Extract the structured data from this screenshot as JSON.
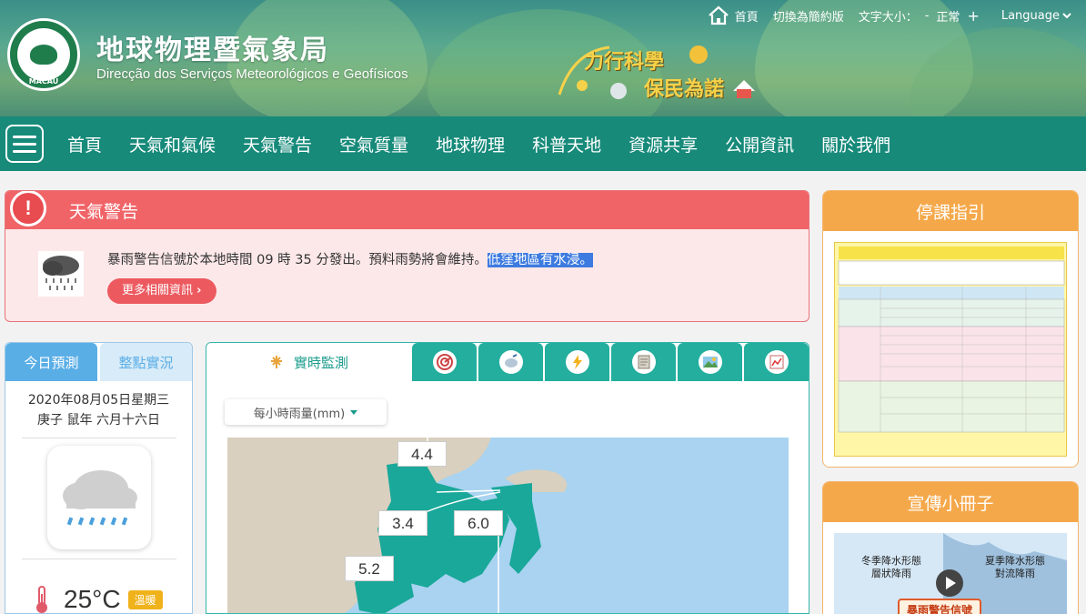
{
  "header": {
    "site_title": "地球物理暨氣象局",
    "site_subtitle": "Direcção dos Serviços Meteorológicos e Geofísicos",
    "logo_text": "MACAU",
    "slogan_line1": "力行科學",
    "slogan_line2": "保民為諾",
    "top_links": {
      "home": "首頁",
      "simplified": "切換為簡約版",
      "font_size_label": "文字大小：",
      "font_minus": "-",
      "font_normal": "正常",
      "font_plus": "+",
      "language": "Language"
    }
  },
  "nav": {
    "items": [
      "首頁",
      "天氣和氣候",
      "天氣警告",
      "空氣質量",
      "地球物理",
      "科普天地",
      "資源共享",
      "公開資訊",
      "關於我們"
    ]
  },
  "warning": {
    "title": "天氣警告",
    "text_main": "暴雨警告信號於本地時間 09 時 35 分發出。預料雨勢將會維持。",
    "text_highlight": "低窪地區有水浸。",
    "more_button": "更多相關資訊"
  },
  "forecast": {
    "tab_today": "今日預測",
    "tab_hourly": "整點實況",
    "date_line1": "2020年08月05日星期三",
    "date_line2": "庚子 鼠年 六月十六日",
    "temperature": "25°C",
    "temp_tag": "溫暖"
  },
  "monitor": {
    "active_tab": "實時監測",
    "icon_tabs": [
      "radar-icon",
      "satellite-icon",
      "lightning-icon",
      "document-icon",
      "landscape-icon",
      "chart-icon"
    ],
    "select_value": "每小時雨量(mm)",
    "map_labels": [
      "4.4",
      "3.4",
      "6.0",
      "5.2"
    ]
  },
  "sidebar": {
    "class_suspension_title": "停課指引",
    "booklet_title": "宣傳小冊子",
    "booklet_left": "冬季降水形態\n層狀降雨",
    "booklet_right": "夏季降水形態\n對流降雨",
    "booklet_bottom": "暴雨警告信號"
  },
  "colors": {
    "nav": "#178a7a",
    "warning_head": "#f06468",
    "forecast_tab": "#5aaee6",
    "monitor_tab": "#23ae9e",
    "side_head": "#f5a84a",
    "highlight": "#3d7be0"
  }
}
